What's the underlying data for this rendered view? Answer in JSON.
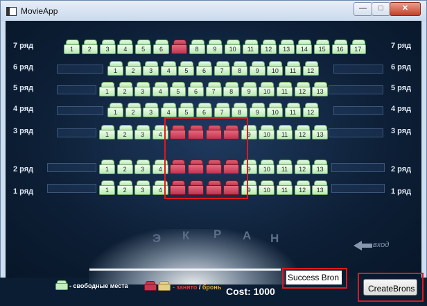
{
  "window": {
    "title": "MovieApp",
    "min_label": "—",
    "max_label": "□",
    "close_label": "✕"
  },
  "rows": [
    {
      "label": "7 ряд",
      "seats": [
        "1",
        "2",
        "3",
        "4",
        "5",
        "6",
        "7",
        "8",
        "9",
        "10",
        "11",
        "12",
        "13",
        "14",
        "15",
        "16",
        "17"
      ],
      "busy": [
        "7"
      ]
    },
    {
      "label": "6 ряд",
      "seats": [
        "1",
        "2",
        "3",
        "4",
        "5",
        "6",
        "7",
        "8",
        "9",
        "10",
        "11",
        "12"
      ],
      "busy": []
    },
    {
      "label": "5 ряд",
      "seats": [
        "1",
        "2",
        "3",
        "4",
        "5",
        "6",
        "7",
        "8",
        "9",
        "10",
        "11",
        "12",
        "13"
      ],
      "busy": []
    },
    {
      "label": "4 ряд",
      "seats": [
        "1",
        "2",
        "3",
        "4",
        "5",
        "6",
        "7",
        "8",
        "9",
        "10",
        "11",
        "12"
      ],
      "busy": []
    },
    {
      "label": "3 ряд",
      "seats": [
        "1",
        "2",
        "3",
        "4",
        "5",
        "6",
        "7",
        "8",
        "9",
        "10",
        "11",
        "12",
        "13"
      ],
      "busy": [
        "5",
        "6",
        "7",
        "8"
      ]
    },
    {
      "label": "2 ряд",
      "seats": [
        "1",
        "2",
        "3",
        "4",
        "5",
        "6",
        "7",
        "8",
        "9",
        "10",
        "11",
        "12",
        "13"
      ],
      "busy": [
        "5",
        "6",
        "7",
        "8"
      ]
    },
    {
      "label": "1 ряд",
      "seats": [
        "1",
        "2",
        "3",
        "4",
        "5",
        "6",
        "7",
        "8",
        "9",
        "10",
        "11",
        "12",
        "13"
      ],
      "busy": [
        "5",
        "6",
        "7",
        "8"
      ]
    }
  ],
  "screen": {
    "letters": [
      "Э",
      "К",
      "Р",
      "А",
      "Н"
    ]
  },
  "entry_label": "вход",
  "legend": {
    "free": "- свободные места",
    "busy": "- занято",
    "slash": " / ",
    "bron": "бронь"
  },
  "cost": {
    "label": "Cost:",
    "value": "1000"
  },
  "status_text": "Success Bron",
  "create_button": "CreateBrons",
  "colors": {
    "free_seat": "#b9eab2",
    "busy_seat": "#c0344e",
    "bron_seat": "#e2cf8e",
    "hall_background": "#0d1f36",
    "highlight": "#e0181c"
  }
}
